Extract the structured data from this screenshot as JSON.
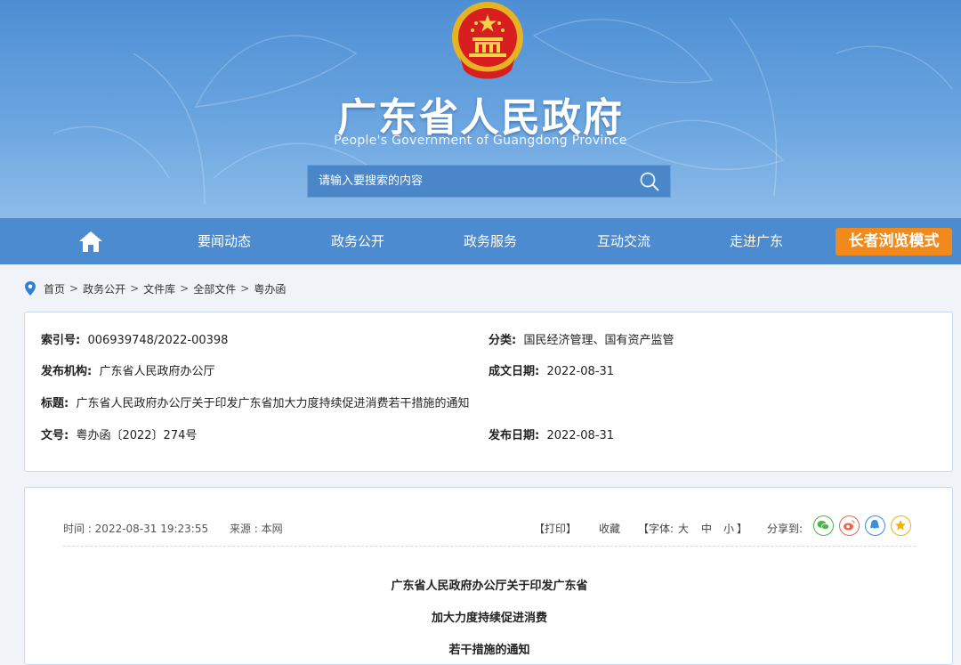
{
  "site": {
    "title": "广东省人民政府",
    "subtitle": "People's Government of Guangdong Province"
  },
  "search": {
    "placeholder": "请输入要搜索的内容"
  },
  "nav": {
    "items": [
      "要闻动态",
      "政务公开",
      "政务服务",
      "互动交流",
      "走进广东"
    ],
    "elder_mode": "长者浏览模式"
  },
  "breadcrumb": [
    "首页",
    "政务公开",
    "文件库",
    "全部文件",
    "粤办函"
  ],
  "info": {
    "index_label": "索引号:",
    "index_value": "006939748/2022-00398",
    "category_label": "分类:",
    "category_value": "国民经济管理、国有资产监管",
    "issuer_label": "发布机构:",
    "issuer_value": "广东省人民政府办公厅",
    "written_label": "成文日期:",
    "written_value": "2022-08-31",
    "title_label": "标题:",
    "title_value": "广东省人民政府办公厅关于印发广东省加大力度持续促进消费若干措施的通知",
    "docno_label": "文号:",
    "docno_value": "粤办函〔2022〕274号",
    "published_label": "发布日期:",
    "published_value": "2022-08-31"
  },
  "article": {
    "time": "时间 : 2022-08-31 19:23:55",
    "source": "来源 : 本网",
    "print": "【打印】",
    "favorite": "收藏",
    "font_open": "【字体:",
    "font_large": "大",
    "font_medium": "中",
    "font_small": "小",
    "font_close": "】",
    "share_label": "分享到:",
    "headings": [
      "广东省人民政府办公厅关于印发广东省",
      "加大力度持续促进消费",
      "若干措施的通知"
    ]
  },
  "colors": {
    "header_top": "#4d8ed3",
    "nav": "#4c8bcf",
    "elder_button": "#f28a1b",
    "wechat": "#4cb648",
    "weibo": "#e8674a",
    "qq": "#3a8fd9",
    "qzone": "#f0b400"
  },
  "icons": [
    "emblem-icon",
    "search-icon",
    "home-icon",
    "location-pin-icon",
    "wechat-icon",
    "weibo-icon",
    "qq-icon",
    "qzone-icon"
  ]
}
